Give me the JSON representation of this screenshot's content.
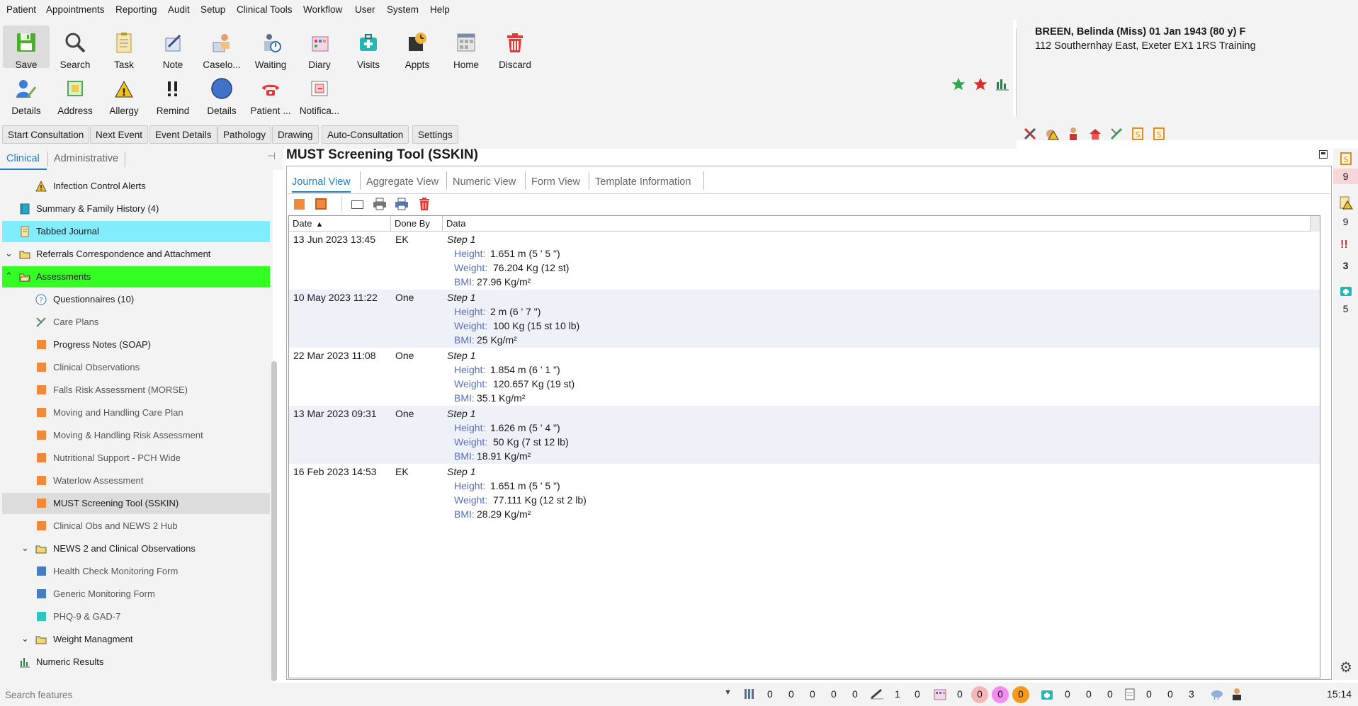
{
  "menu": [
    "Patient",
    "Appointments",
    "Reporting",
    "Audit",
    "Setup",
    "Clinical Tools",
    "Workflow",
    "User",
    "System",
    "Help"
  ],
  "toolbar": {
    "row1": [
      "Save",
      "Search",
      "Task",
      "Note",
      "Caselo...",
      "Waiting",
      "Diary",
      "Visits",
      "Appts",
      "Home",
      "Discard"
    ],
    "row2": [
      "Details",
      "Address",
      "Allergy",
      "Remind",
      "Details",
      "Patient ...",
      "Notifica..."
    ]
  },
  "patient": {
    "name_line": "BREEN, Belinda (Miss) 01 Jan 1943 (80 y) F",
    "address_line": "112 Southernhay East, Exeter EX1 1RS  Training"
  },
  "action_buttons": [
    "Start Consultation",
    "Next Event",
    "Event Details",
    "Pathology",
    "Drawing",
    "Auto-Consultation",
    "Settings"
  ],
  "left_tabs": {
    "clinical": "Clinical",
    "administrative": "Administrative"
  },
  "tree": [
    {
      "label": "Infection Control Alerts",
      "icon": "warning-icon"
    },
    {
      "label": "Summary & Family History (4)",
      "icon": "book-icon"
    },
    {
      "label": "Tabbed Journal",
      "icon": "journal-icon"
    },
    {
      "label": "Referrals Correspondence and Attachment",
      "icon": "folder-icon"
    },
    {
      "label": "Assessments",
      "icon": "folder-open-icon"
    },
    {
      "label": "Questionnaires (10)",
      "icon": "question-icon"
    },
    {
      "label": "Care Plans",
      "icon": "careplan-icon"
    },
    {
      "label": "Progress Notes (SOAP)",
      "icon": "orange-square-icon"
    },
    {
      "label": "Clinical Observations",
      "icon": "orange-square-icon"
    },
    {
      "label": "Falls Risk Assessment (MORSE)",
      "icon": "orange-square-icon"
    },
    {
      "label": "Moving and Handling Care Plan",
      "icon": "orange-square-icon"
    },
    {
      "label": "Moving & Handling Risk Assessment",
      "icon": "orange-square-icon"
    },
    {
      "label": "Nutritional Support - PCH Wide",
      "icon": "orange-square-icon"
    },
    {
      "label": "Waterlow Assessment",
      "icon": "orange-square-icon"
    },
    {
      "label": "MUST Screening Tool (SSKIN)",
      "icon": "orange-square-icon"
    },
    {
      "label": "Clinical Obs and NEWS 2 Hub",
      "icon": "orange-square-icon"
    },
    {
      "label": "NEWS 2 and Clinical Observations",
      "icon": "folder-icon"
    },
    {
      "label": "Health Check Monitoring Form",
      "icon": "blue-square-icon"
    },
    {
      "label": "Generic Monitoring Form",
      "icon": "blue-square-icon"
    },
    {
      "label": "PHQ-9 & GAD-7",
      "icon": "teal-square-icon"
    },
    {
      "label": "Weight Managment",
      "icon": "folder-icon"
    },
    {
      "label": "Numeric Results",
      "icon": "chart-icon"
    }
  ],
  "search": {
    "placeholder": "Search features"
  },
  "main": {
    "title": "MUST Screening Tool (SSKIN)",
    "tabs": [
      "Journal View",
      "Aggregate View",
      "Numeric View",
      "Form View",
      "Template Information"
    ],
    "columns": [
      "Date",
      "Done By",
      "Data"
    ],
    "rows": [
      {
        "date": "13 Jun 2023 13:45",
        "by": "EK",
        "step": "Step 1",
        "height": "1.651 m  (5 ' 5 \")",
        "weight": "76.204 Kg  (12 st)",
        "bmi": "27.96 Kg/m²"
      },
      {
        "date": "10 May 2023 11:22",
        "by": "One",
        "step": "Step 1",
        "height": "2 m  (6 ' 7 \")",
        "weight": "100 Kg  (15 st 10 lb)",
        "bmi": "25 Kg/m²"
      },
      {
        "date": "22 Mar 2023 11:08",
        "by": "One",
        "step": "Step 1",
        "height": "1.854 m  (6 ' 1 \")",
        "weight": "120.657 Kg  (19 st)",
        "bmi": "35.1 Kg/m²"
      },
      {
        "date": "13 Mar 2023 09:31",
        "by": "One",
        "step": "Step 1",
        "height": "1.626 m  (5 ' 4 \")",
        "weight": "50 Kg  (7 st 12 lb)",
        "bmi": "18.91 Kg/m²"
      },
      {
        "date": "16 Feb 2023 14:53",
        "by": "EK",
        "step": "Step 1",
        "height": "1.651 m  (5 ' 5 \")",
        "weight": "77.111 Kg  (12 st 2 lb)",
        "bmi": "28.29 Kg/m²"
      }
    ],
    "labels": {
      "height": "Height:",
      "weight": "Weight:",
      "bmi": "BMI:"
    }
  },
  "right_bar": [
    "9",
    "9",
    "3",
    "5"
  ],
  "status": {
    "group1": [
      "0",
      "0",
      "0",
      "0",
      "0"
    ],
    "group2": [
      "1",
      "0"
    ],
    "group3": [
      "0"
    ],
    "pills": [
      "0",
      "0",
      "0"
    ],
    "group4": [
      "0",
      "0",
      "0"
    ],
    "group5": [
      "0",
      "0",
      "3"
    ],
    "time": "15:14"
  },
  "colors": {
    "tabbed_journal_highlight": "#80eeff",
    "assessments_highlight": "#33ff22",
    "selected_item": "#dcdcdc",
    "accent": "#1f7fc7"
  }
}
